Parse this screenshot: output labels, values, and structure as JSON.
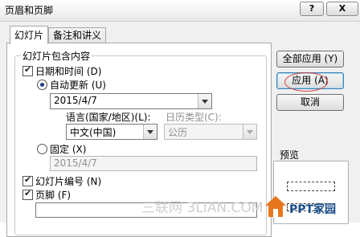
{
  "window": {
    "title": "页眉和页脚",
    "help_label": "?",
    "close_label": "X"
  },
  "tabs": [
    {
      "label": "幻灯片",
      "active": true
    },
    {
      "label": "备注和讲义",
      "active": false
    }
  ],
  "slide_group": {
    "title": "幻灯片包含内容"
  },
  "date_time": {
    "checkbox_label": "日期和时间 (D)",
    "checked": true,
    "auto_update": {
      "label": "自动更新 (U)",
      "selected": true,
      "date_value": "2015/4/7"
    },
    "language": {
      "label": "语言(国家/地区)(L):",
      "value": "中文(中国)"
    },
    "calendar": {
      "label": "日历类型(C):",
      "value": "公历",
      "enabled": false
    },
    "fixed": {
      "label": "固定 (X)",
      "selected": false,
      "value": "2015/4/7"
    }
  },
  "slide_number": {
    "label": "幻灯片编号 (N)",
    "checked": true
  },
  "footer": {
    "label": "页脚 (F)",
    "checked": true,
    "value": ""
  },
  "buttons": {
    "apply_all": "全部应用 (Y)",
    "apply": "应用 (A)",
    "cancel": "取消"
  },
  "preview": {
    "label": "预览"
  },
  "watermark": {
    "text": "三联网 3LIAN.COM",
    "logo_text": "PPT家园"
  },
  "colors": {
    "dialog_bg": "#f0f0f0",
    "annotation_circle": "#d04040",
    "logo_orange": "#e8761c"
  }
}
